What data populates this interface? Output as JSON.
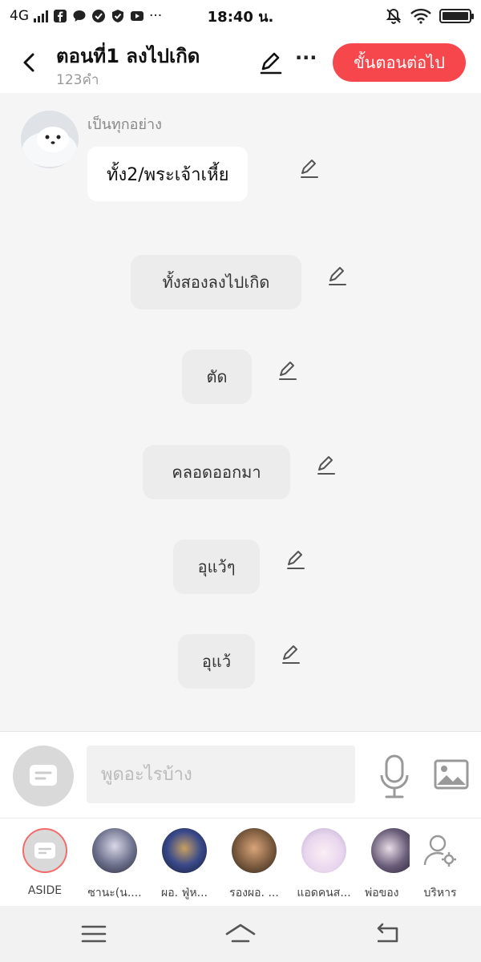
{
  "status_bar": {
    "network": "4G",
    "time": "18:40 น.",
    "more": "···"
  },
  "header": {
    "title": "ตอนที่1 ลงไปเกิด",
    "subtitle": "123คำ",
    "more_label": "···",
    "next_label": "ขั้นตอนต่อไป"
  },
  "chat": {
    "speaker_name": "เป็นทุกอย่าง",
    "first_message": "ทั้ง2/พระเจ้าเหี้ย",
    "narration": [
      "ทั้งสองลงไปเกิด",
      "ตัด",
      "คลอดออกมา",
      "อุแว้ๆ",
      "อุแว้"
    ]
  },
  "input": {
    "placeholder": "พูดอะไรบ้าง"
  },
  "characters": [
    {
      "name": "ASIDE"
    },
    {
      "name": "ซานะ(น...."
    },
    {
      "name": "ผอ.  ฟู่ห..."
    },
    {
      "name": "รองผอ. ..."
    },
    {
      "name": "แอดคนส..."
    },
    {
      "name": "พ่อของ"
    },
    {
      "name": "บริหาร"
    }
  ],
  "colors": {
    "accent": "#f6474c",
    "background": "#f5f5f5",
    "bubble_narration": "#ececec"
  }
}
